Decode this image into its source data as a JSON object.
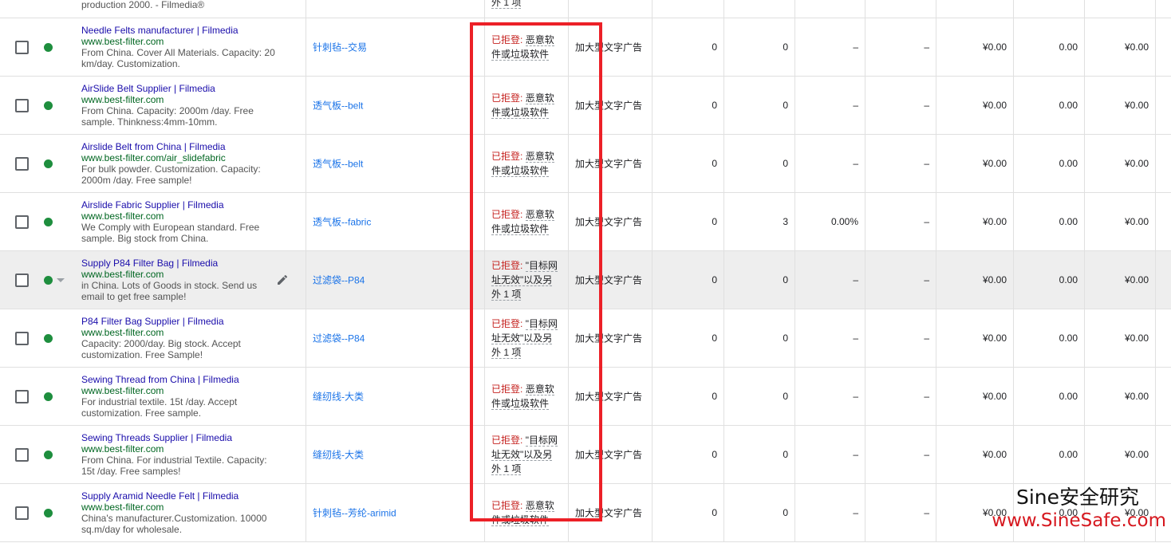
{
  "top_row": {
    "desc": "production 2000. - Filmedia®",
    "policy_tail": "外 1 项"
  },
  "rows": [
    {
      "title": "Needle Felts manufacturer | Filmedia",
      "url": "www.best-filter.com",
      "desc": "From China. Cover All Materials. Capacity: 20 km/day. Customization.",
      "group": "针刺毡--交易",
      "rejected": "已拒登:",
      "reason": "恶意软件或垃圾软件",
      "type": "加大型文字广告",
      "n1": "0",
      "n2": "0",
      "n3": "–",
      "n4": "–",
      "n5": "¥0.00",
      "n6": "0.00",
      "n7": "¥0.00"
    },
    {
      "title": "AirSlide Belt Supplier | Filmedia",
      "url": "www.best-filter.com",
      "desc": "From China. Capacity: 2000m /day. Free sample. Thinkness:4mm-10mm.",
      "group": "透气板--belt",
      "rejected": "已拒登:",
      "reason": "恶意软件或垃圾软件",
      "type": "加大型文字广告",
      "n1": "0",
      "n2": "0",
      "n3": "–",
      "n4": "–",
      "n5": "¥0.00",
      "n6": "0.00",
      "n7": "¥0.00"
    },
    {
      "title": "Airslide Belt from China | Filmedia",
      "url": "www.best-filter.com/air_slidefabric",
      "desc": "For bulk powder. Customization. Capacity: 2000m /day. Free sample!",
      "group": "透气板--belt",
      "rejected": "已拒登:",
      "reason": "恶意软件或垃圾软件",
      "type": "加大型文字广告",
      "n1": "0",
      "n2": "0",
      "n3": "–",
      "n4": "–",
      "n5": "¥0.00",
      "n6": "0.00",
      "n7": "¥0.00"
    },
    {
      "title": "Airslide Fabric Supplier | Filmedia",
      "url": "www.best-filter.com",
      "desc": "We Comply with European standard. Free sample. Big stock from China.",
      "group": "透气板--fabric",
      "rejected": "已拒登:",
      "reason": "恶意软件或垃圾软件",
      "type": "加大型文字广告",
      "n1": "0",
      "n2": "3",
      "n3": "0.00%",
      "n4": "–",
      "n5": "¥0.00",
      "n6": "0.00",
      "n7": "¥0.00"
    },
    {
      "title": "Supply P84 Filter Bag | Filmedia",
      "url": "www.best-filter.com",
      "desc": "in China. Lots of Goods in stock. Send us email to get free sample!",
      "group": "过滤袋--P84",
      "rejected": "已拒登:",
      "reason": "\"目标网址无效\"以及另外 1 项",
      "type": "加大型文字广告",
      "n1": "0",
      "n2": "0",
      "n3": "–",
      "n4": "–",
      "n5": "¥0.00",
      "n6": "0.00",
      "n7": "¥0.00"
    },
    {
      "title": "P84 Filter Bag Supplier | Filmedia",
      "url": "www.best-filter.com",
      "desc": "Capacity: 2000/day. Big stock. Accept customization. Free Sample!",
      "group": "过滤袋--P84",
      "rejected": "已拒登:",
      "reason": "\"目标网址无效\"以及另外 1 项",
      "type": "加大型文字广告",
      "n1": "0",
      "n2": "0",
      "n3": "–",
      "n4": "–",
      "n5": "¥0.00",
      "n6": "0.00",
      "n7": "¥0.00"
    },
    {
      "title": "Sewing Thread from China | Filmedia",
      "url": "www.best-filter.com",
      "desc": "For industrial textile. 15t /day. Accept customization. Free sample.",
      "group": "缝纫线-大类",
      "rejected": "已拒登:",
      "reason": "恶意软件或垃圾软件",
      "type": "加大型文字广告",
      "n1": "0",
      "n2": "0",
      "n3": "–",
      "n4": "–",
      "n5": "¥0.00",
      "n6": "0.00",
      "n7": "¥0.00"
    },
    {
      "title": "Sewing Threads Supplier | Filmedia",
      "url": "www.best-filter.com",
      "desc": "From China. For industrial Textile. Capacity: 15t /day. Free samples!",
      "group": "缝纫线-大类",
      "rejected": "已拒登:",
      "reason": "\"目标网址无效\"以及另外 1 项",
      "type": "加大型文字广告",
      "n1": "0",
      "n2": "0",
      "n3": "–",
      "n4": "–",
      "n5": "¥0.00",
      "n6": "0.00",
      "n7": "¥0.00"
    },
    {
      "title": "Supply Aramid Needle Felt | Filmedia",
      "url": "www.best-filter.com",
      "desc": "China's manufacturer.Customization. 10000 sq.m/day for wholesale.",
      "group": "针刺毡--芳纶-arimid",
      "rejected": "已拒登:",
      "reason": "恶意软件或垃圾软件",
      "type": "加大型文字广告",
      "n1": "0",
      "n2": "0",
      "n3": "–",
      "n4": "–",
      "n5": "¥0.00",
      "n6": "0.00",
      "n7": "¥0.00"
    }
  ],
  "hovered_row": 4,
  "watermark": {
    "line1": "Sine安全研究",
    "line2": "www.SineSafe.com"
  },
  "colors": {
    "highlight": "#ec2027",
    "status_green": "#1e8e3e",
    "rejected_red": "#c5221f",
    "link_blue": "#1a0dab",
    "url_green": "#006621"
  }
}
